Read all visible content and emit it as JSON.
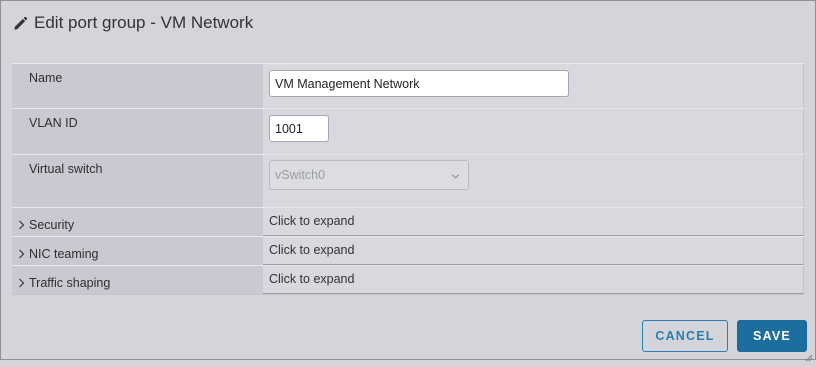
{
  "dialog": {
    "title": "Edit port group - VM Network",
    "title_icon": "pencil-icon"
  },
  "fields": {
    "name": {
      "label": "Name",
      "value": "VM Management Network"
    },
    "vlan": {
      "label": "VLAN ID",
      "value": "1001"
    },
    "virtual_switch": {
      "label": "Virtual switch",
      "value": "vSwitch0",
      "disabled": true
    }
  },
  "sections": [
    {
      "label": "Security",
      "value": "Click to expand"
    },
    {
      "label": "NIC teaming",
      "value": "Click to expand"
    },
    {
      "label": "Traffic shaping",
      "value": "Click to expand"
    }
  ],
  "buttons": {
    "cancel": "CANCEL",
    "save": "SAVE"
  },
  "colors": {
    "primary": "#1b6e9e",
    "link": "#2b7fb0",
    "background": "#d4d5db"
  }
}
